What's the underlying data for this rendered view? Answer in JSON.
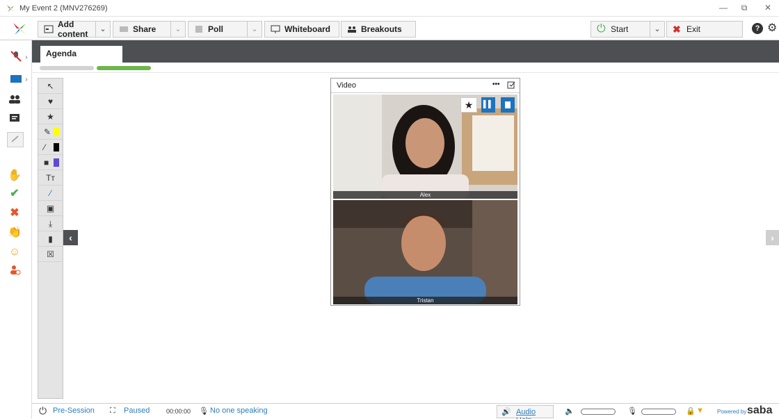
{
  "window": {
    "title": "My Event 2 (MNV276269)",
    "minimize_glyph": "—",
    "restore_glyph": "⧉",
    "close_glyph": "✕"
  },
  "toolbar": {
    "add_content": "Add content",
    "share": "Share",
    "poll": "Poll",
    "whiteboard": "Whiteboard",
    "breakouts": "Breakouts",
    "start": "Start",
    "exit": "Exit",
    "help_glyph": "?",
    "settings_glyph": "⚙",
    "dropdown_glyph": "⌄"
  },
  "tabs": [
    {
      "label": "Agenda",
      "active": true
    }
  ],
  "progress": {
    "segment1_color": "#d2d2d2",
    "segment2_color": "#6db74a"
  },
  "whiteboard_tools": [
    {
      "name": "pointer-icon",
      "glyph": "↖"
    },
    {
      "name": "highlight-icon",
      "glyph": "♥"
    },
    {
      "name": "stamp-icon",
      "glyph": "★"
    },
    {
      "name": "highlighter-icon",
      "glyph": "✎"
    },
    {
      "name": "pen-icon",
      "glyph": "⁄"
    },
    {
      "name": "shape-fill-icon",
      "glyph": "■"
    },
    {
      "name": "text-icon",
      "glyph": "Tт"
    },
    {
      "name": "line-icon",
      "glyph": "⁄"
    },
    {
      "name": "save-icon",
      "glyph": "▣"
    },
    {
      "name": "download-icon",
      "glyph": "⤓"
    },
    {
      "name": "delete-icon",
      "glyph": "▮"
    },
    {
      "name": "clear-icon",
      "glyph": "☒"
    }
  ],
  "video": {
    "title": "Video",
    "more_glyph": "•••",
    "participants": [
      {
        "name": "Alex"
      },
      {
        "name": "Tristan"
      }
    ]
  },
  "nav": {
    "prev_glyph": "‹",
    "next_glyph": "›"
  },
  "status": {
    "session": "Pre-Session",
    "paused": "Paused",
    "timer": "00:00:00",
    "speaking": "No one speaking",
    "audio_help": "Audio Help",
    "powered_by": "Powered by",
    "brand": "saba"
  },
  "colors": {
    "accent_blue": "#2c7cbf",
    "start_green": "#4caf50",
    "exit_red": "#d32f2f",
    "dark_strip": "#4d4f52"
  }
}
